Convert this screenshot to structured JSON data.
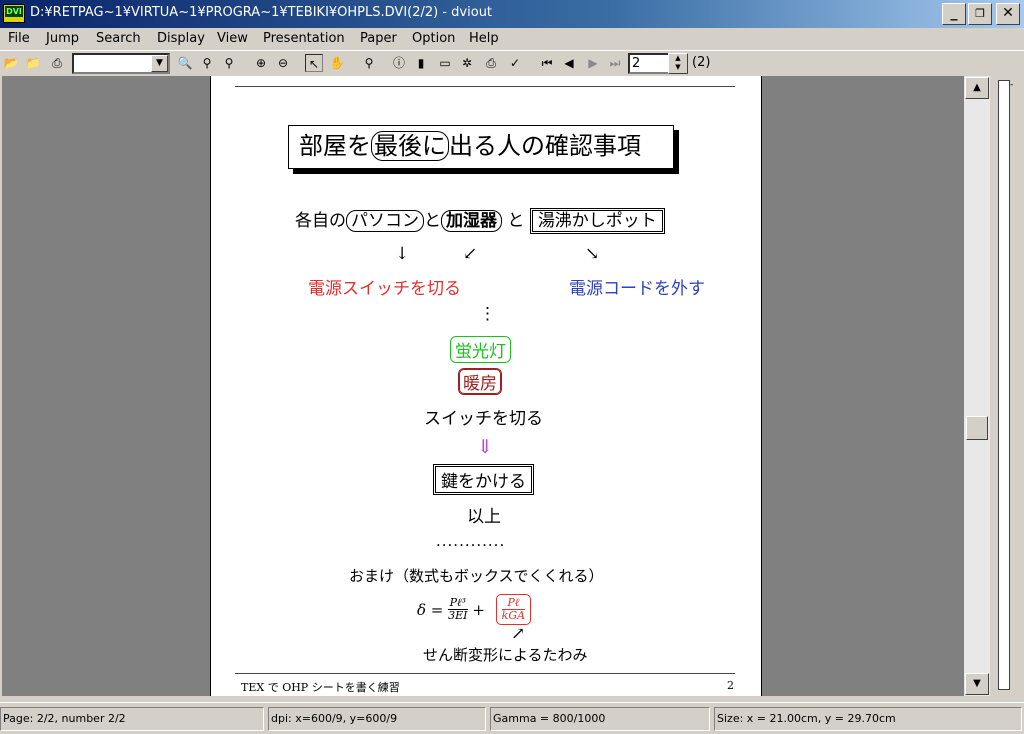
{
  "window": {
    "title": "D:¥RETPAG~1¥VIRTUA~1¥PROGRA~1¥TEBIKI¥OHPLS.DVI(2/2) - dviout",
    "icon_label": "DVI"
  },
  "menu": [
    "File",
    "Jump",
    "Search",
    "Display",
    "View",
    "Presentation",
    "Paper",
    "Option",
    "Help"
  ],
  "toolbar": {
    "zoom_value": "",
    "page_value": "2",
    "page_total": "(2)"
  },
  "document": {
    "title_pre": "部屋を",
    "title_box": "最後に",
    "title_post": "出る人の確認事項",
    "line1_pre": "各自の",
    "pc": "パソコン",
    "to1": "と",
    "humidifier": "加湿器",
    "to2": "と",
    "kettle": "湯沸かしポット",
    "arrow_down": "↓",
    "arrow_sw": "↙",
    "arrow_se": "↘",
    "switch_off_red": "電源スイッチを切る",
    "unplug_blue": "電源コードを外す",
    "vdots": "⋮",
    "fluorescent": "蛍光灯",
    "heater": "暖房",
    "switch_off": "スイッチを切る",
    "double_arrow": "⇓",
    "lock": "鍵をかける",
    "end": "以上",
    "dots": "............",
    "bonus": "おまけ（数式もボックスでくくれる）",
    "formula_delta": "δ =",
    "frac1_num": "Pℓ³",
    "frac1_den": "3EI",
    "plus": "+",
    "frac2_num": "Pℓ",
    "frac2_den": "kGA",
    "arrow_ne": "↗",
    "shear": "せん断変形によるたわみ",
    "footer_left": "TEX で OHP シートを書く練習",
    "footer_page": "2"
  },
  "status": {
    "page": "Page: 2/2, number 2/2",
    "dpi": "dpi: x=600/9, y=600/9",
    "gamma": "Gamma = 800/1000",
    "size": "Size: x = 21.00cm, y = 29.70cm"
  },
  "colors": {
    "red": "#e03030",
    "blue": "#3040c0",
    "green": "#20c020",
    "brown": "#a02020",
    "purple": "#c040e0"
  }
}
